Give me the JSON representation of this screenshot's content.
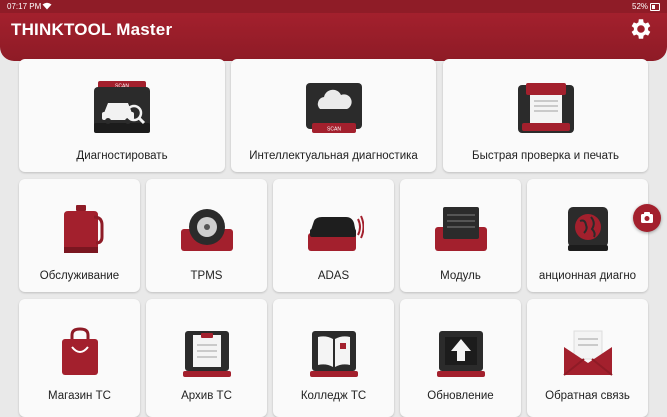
{
  "status_bar": {
    "time": "07:17 PM",
    "battery": "52%"
  },
  "header": {
    "title": "THINKTOOL Master"
  },
  "tiles": {
    "diagnose": "Диагностировать",
    "smart_diag": "Интеллектуальная диагностика",
    "quick_check": "Быстрая проверка и печать",
    "service": "Обслуживание",
    "tpms": "TPMS",
    "adas": "ADAS",
    "module": "Модуль",
    "remote_diag": "анционная диагно",
    "shop": "Магазин ТС",
    "archive": "Архив ТС",
    "college": "Колледж ТС",
    "update": "Обновление",
    "feedback": "Обратная связь"
  },
  "colors": {
    "brand": "#a3202d",
    "header": "#8e1b26",
    "background": "#e9e9e9"
  },
  "icons": {
    "settings": "gear-icon",
    "camera": "camera-icon",
    "wifi": "wifi-icon"
  }
}
